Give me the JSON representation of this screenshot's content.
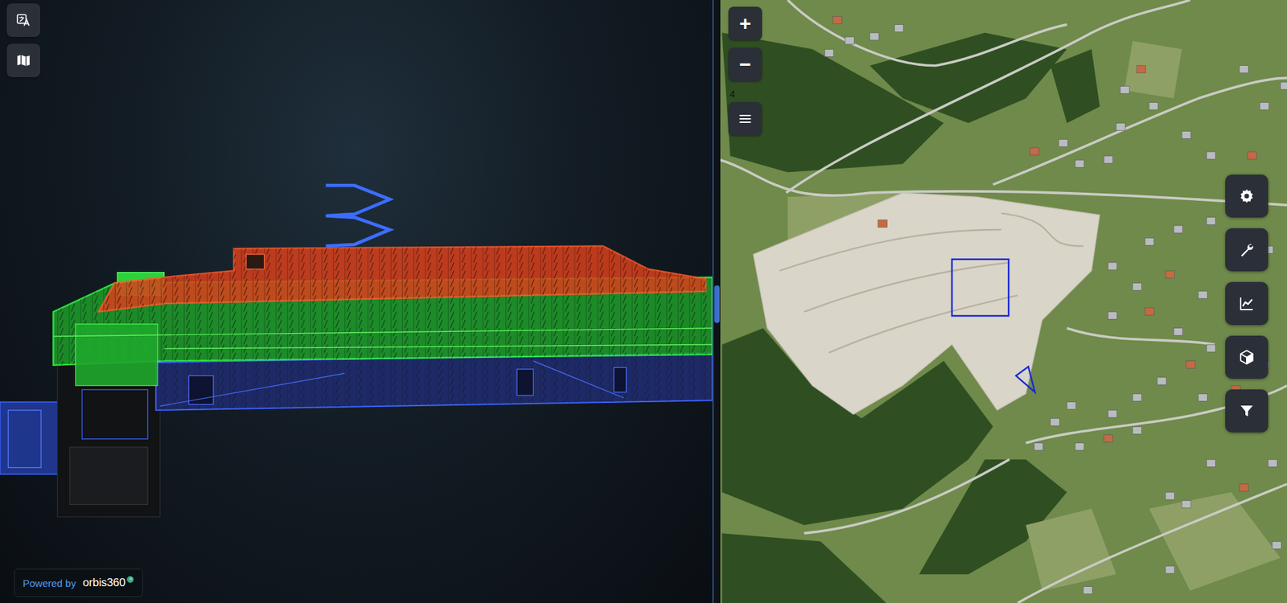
{
  "viewer": {
    "branding": {
      "prefix": "Powered by",
      "logo": "orbis360"
    }
  },
  "map": {
    "zoom_controls": [
      "+",
      "−"
    ],
    "zoom_level": "4"
  }
}
